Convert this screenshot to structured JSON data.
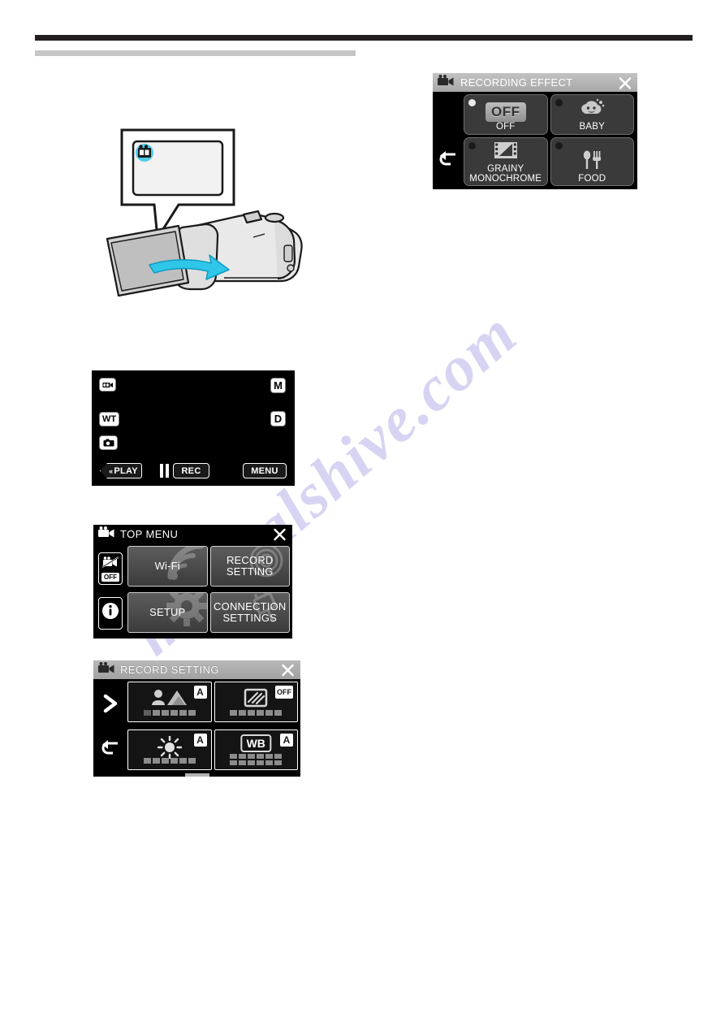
{
  "page": {
    "watermark": "manualshive.com",
    "rule_dark_color": "#231f20",
    "rule_light_color": "#c6c6c6"
  },
  "illustration": {
    "name": "camcorder-open-lcd",
    "callout_icon": "video-mode-icon",
    "highlight_color": "#29c3e8",
    "arrow_color": "#29c3e8"
  },
  "rec_screen": {
    "icons": {
      "video_mode": "video-camera-icon",
      "zoom": "WT",
      "still": "still-camera-icon",
      "manual": "M",
      "display": "D"
    },
    "buttons": {
      "play": "PLAY",
      "record": "REC",
      "menu": "MENU",
      "pause": "pause-icon"
    }
  },
  "top_menu": {
    "title": "TOP MENU",
    "close_label": "close-icon",
    "rail": [
      {
        "name": "silent-mode",
        "icon": "mute-icon",
        "state": "OFF"
      },
      {
        "name": "info",
        "icon": "info-icon"
      }
    ],
    "tiles": [
      {
        "label": "Wi-Fi",
        "ghost": "wifi-icon"
      },
      {
        "label": "RECORD\nSETTING",
        "ghost": "shutter-icon"
      },
      {
        "label": "SETUP",
        "ghost": "gear-icon"
      },
      {
        "label": "CONNECTION\nSETTINGS",
        "ghost": "plug-icon"
      }
    ]
  },
  "record_setting": {
    "title": "RECORD SETTING",
    "close_label": "close-icon",
    "rail": [
      {
        "name": "next-page",
        "icon": "chevron-right-icon"
      },
      {
        "name": "back",
        "icon": "back-arrow-icon"
      }
    ],
    "tiles": [
      {
        "name": "focus",
        "icon": "person-mountain-icon",
        "badge": "A",
        "bars": 6,
        "dim_first": 1
      },
      {
        "name": "backlight-comp",
        "icon": "backlight-icon",
        "badge": "OFF",
        "bars": 6,
        "dim_first": 0
      },
      {
        "name": "brightness",
        "icon": "sun-icon",
        "badge": "A",
        "bars": 6,
        "dim_first": 0
      },
      {
        "name": "white-balance",
        "icon": "WB",
        "badge": "A",
        "bars": 12,
        "dim_first": 0
      }
    ]
  },
  "recording_effect": {
    "title": "RECORDING EFFECT",
    "header_icon": "video-camera-icon",
    "close_label": "close-icon",
    "back_label": "back-arrow-icon",
    "options": [
      {
        "label": "OFF",
        "icon": "off-glyph",
        "selected": true
      },
      {
        "label": "BABY",
        "icon": "baby-effect-icon",
        "selected": false
      },
      {
        "label": "GRAINY\nMONOCHROME",
        "icon": "film-frame-icon",
        "selected": false
      },
      {
        "label": "FOOD",
        "icon": "spoon-fork-icon",
        "selected": false
      }
    ]
  }
}
